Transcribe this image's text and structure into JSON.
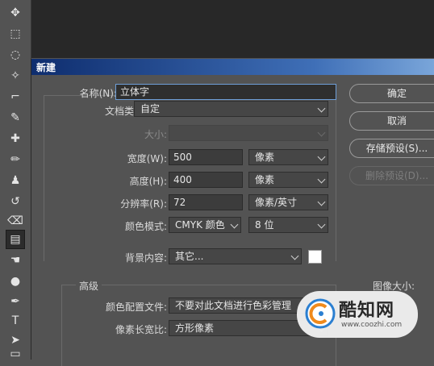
{
  "toolbar": {
    "tools": [
      {
        "name": "move-tool",
        "glyph": "✥"
      },
      {
        "name": "marquee-tool",
        "glyph": "⬚"
      },
      {
        "name": "lasso-tool",
        "glyph": "◌"
      },
      {
        "name": "magic-wand-tool",
        "glyph": "✧"
      },
      {
        "name": "crop-tool",
        "glyph": "⌐"
      },
      {
        "name": "eyedropper-tool",
        "glyph": "✎"
      },
      {
        "name": "healing-brush-tool",
        "glyph": "✚"
      },
      {
        "name": "brush-tool",
        "glyph": "✏"
      },
      {
        "name": "stamp-tool",
        "glyph": "♟"
      },
      {
        "name": "history-brush-tool",
        "glyph": "↺"
      },
      {
        "name": "eraser-tool",
        "glyph": "⌫"
      },
      {
        "name": "gradient-tool",
        "glyph": "▤"
      },
      {
        "name": "smudge-tool",
        "glyph": "☚"
      },
      {
        "name": "dodge-tool",
        "glyph": "●"
      },
      {
        "name": "pen-tool",
        "glyph": "✒"
      },
      {
        "name": "type-tool",
        "glyph": "T"
      },
      {
        "name": "path-selection-tool",
        "glyph": "➤"
      },
      {
        "name": "rectangle-tool",
        "glyph": "▭"
      }
    ]
  },
  "dialog": {
    "title": "新建",
    "name_label": "名称(N):",
    "name_value": "立体字",
    "doc_type_label": "文档类型:",
    "doc_type_value": "自定",
    "size_label": "大小:",
    "size_value": "",
    "width_label": "宽度(W):",
    "width_value": "500",
    "width_unit": "像素",
    "height_label": "高度(H):",
    "height_value": "400",
    "height_unit": "像素",
    "resolution_label": "分辨率(R):",
    "resolution_value": "72",
    "resolution_unit": "像素/英寸",
    "color_mode_label": "颜色模式:",
    "color_mode_value": "CMYK 颜色",
    "bit_depth_value": "8 位",
    "background_label": "背景内容:",
    "background_value": "其它...",
    "background_color": "#ffffff",
    "advanced_title": "高级",
    "color_profile_label": "颜色配置文件:",
    "color_profile_value": "不要对此文档进行色彩管理",
    "pixel_aspect_label": "像素长宽比:",
    "pixel_aspect_value": "方形像素",
    "image_size_label": "图像大小:"
  },
  "buttons": {
    "ok": "确定",
    "cancel": "取消",
    "save_preset": "存储预设(S)...",
    "delete_preset": "删除预设(D)..."
  },
  "watermark": {
    "text": "酷知网",
    "url": "www.coozhi.com"
  },
  "colors": {
    "titlebar_start": "#0e2d6e",
    "titlebar_end": "#7aa6da",
    "panel": "#535353",
    "focus_border": "#6f9fd8"
  }
}
